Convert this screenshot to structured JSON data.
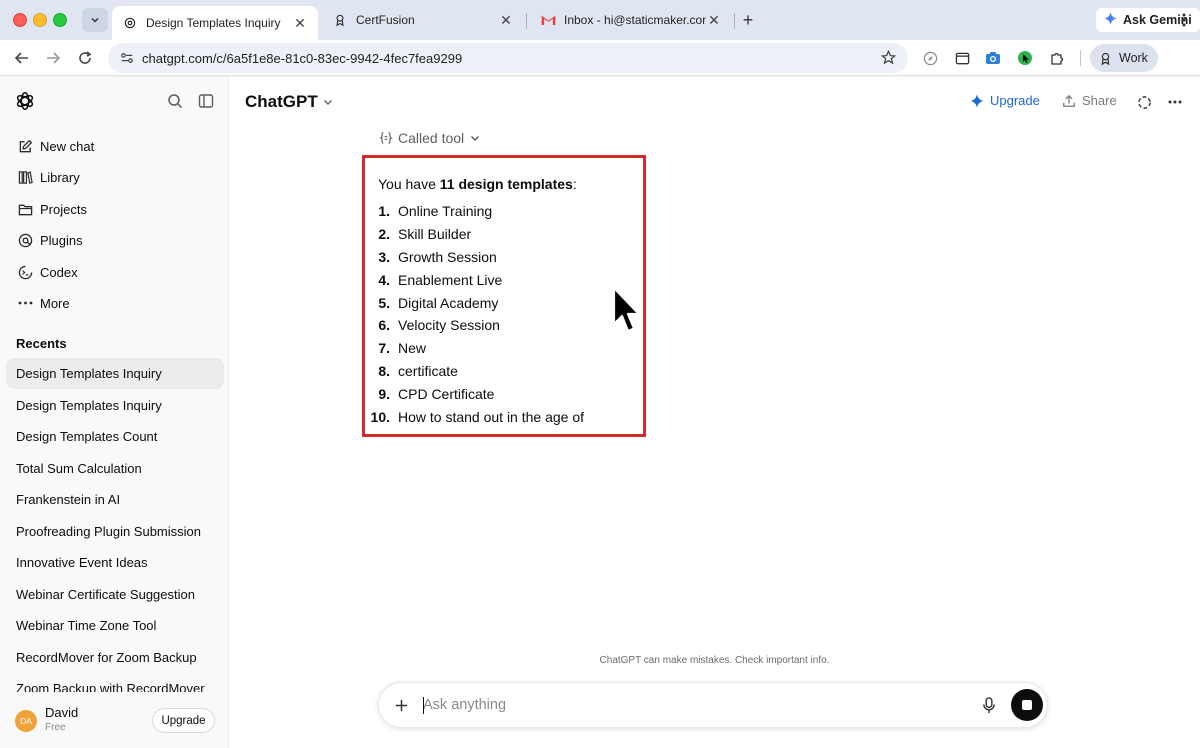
{
  "browser": {
    "tabs": [
      {
        "title": "Design Templates Inquiry",
        "active": true
      },
      {
        "title": "CertFusion",
        "active": false
      },
      {
        "title": "Inbox - hi@staticmaker.com -",
        "active": false
      }
    ],
    "ask_gemini": "Ask Gemini",
    "url": "chatgpt.com/c/6a5f1e8e-81c0-83ec-9942-4fec7fea9299",
    "profile": "Work"
  },
  "sidebar": {
    "nav": [
      {
        "label": "New chat",
        "icon": "edit-icon"
      },
      {
        "label": "Library",
        "icon": "library-icon"
      },
      {
        "label": "Projects",
        "icon": "folder-icon"
      },
      {
        "label": "Plugins",
        "icon": "plugins-icon"
      },
      {
        "label": "Codex",
        "icon": "codex-icon"
      },
      {
        "label": "More",
        "icon": "more-icon"
      }
    ],
    "recents_label": "Recents",
    "recents": [
      "Design Templates Inquiry",
      "Design Templates Inquiry",
      "Design Templates Count",
      "Total Sum Calculation",
      "Frankenstein in AI",
      "Proofreading Plugin Submission",
      "Innovative Event Ideas",
      "Webinar Certificate Suggestion",
      "Webinar Time Zone Tool",
      "RecordMover for Zoom Backup",
      "Zoom Backup with RecordMover"
    ],
    "user": {
      "initials": "DA",
      "name": "David",
      "plan": "Free",
      "upgrade_label": "Upgrade"
    }
  },
  "header": {
    "model": "ChatGPT",
    "upgrade_label": "Upgrade",
    "share_label": "Share"
  },
  "conversation": {
    "called_tool": "Called tool",
    "intro_prefix": "You have ",
    "intro_bold": "11 design templates",
    "intro_suffix": ":",
    "templates": [
      "Online Training",
      "Skill Builder",
      "Growth Session",
      "Enablement Live",
      "Digital Academy",
      "Velocity Session",
      "New",
      "certificate",
      "CPD Certificate",
      "How to stand out in the age of"
    ]
  },
  "composer": {
    "placeholder": "Ask anything",
    "disclaimer": "ChatGPT can make mistakes. Check important info."
  },
  "colors": {
    "highlight_border": "#d42b2b",
    "upgrade_blue": "#1d67d4",
    "avatar": "#f0a23a"
  }
}
